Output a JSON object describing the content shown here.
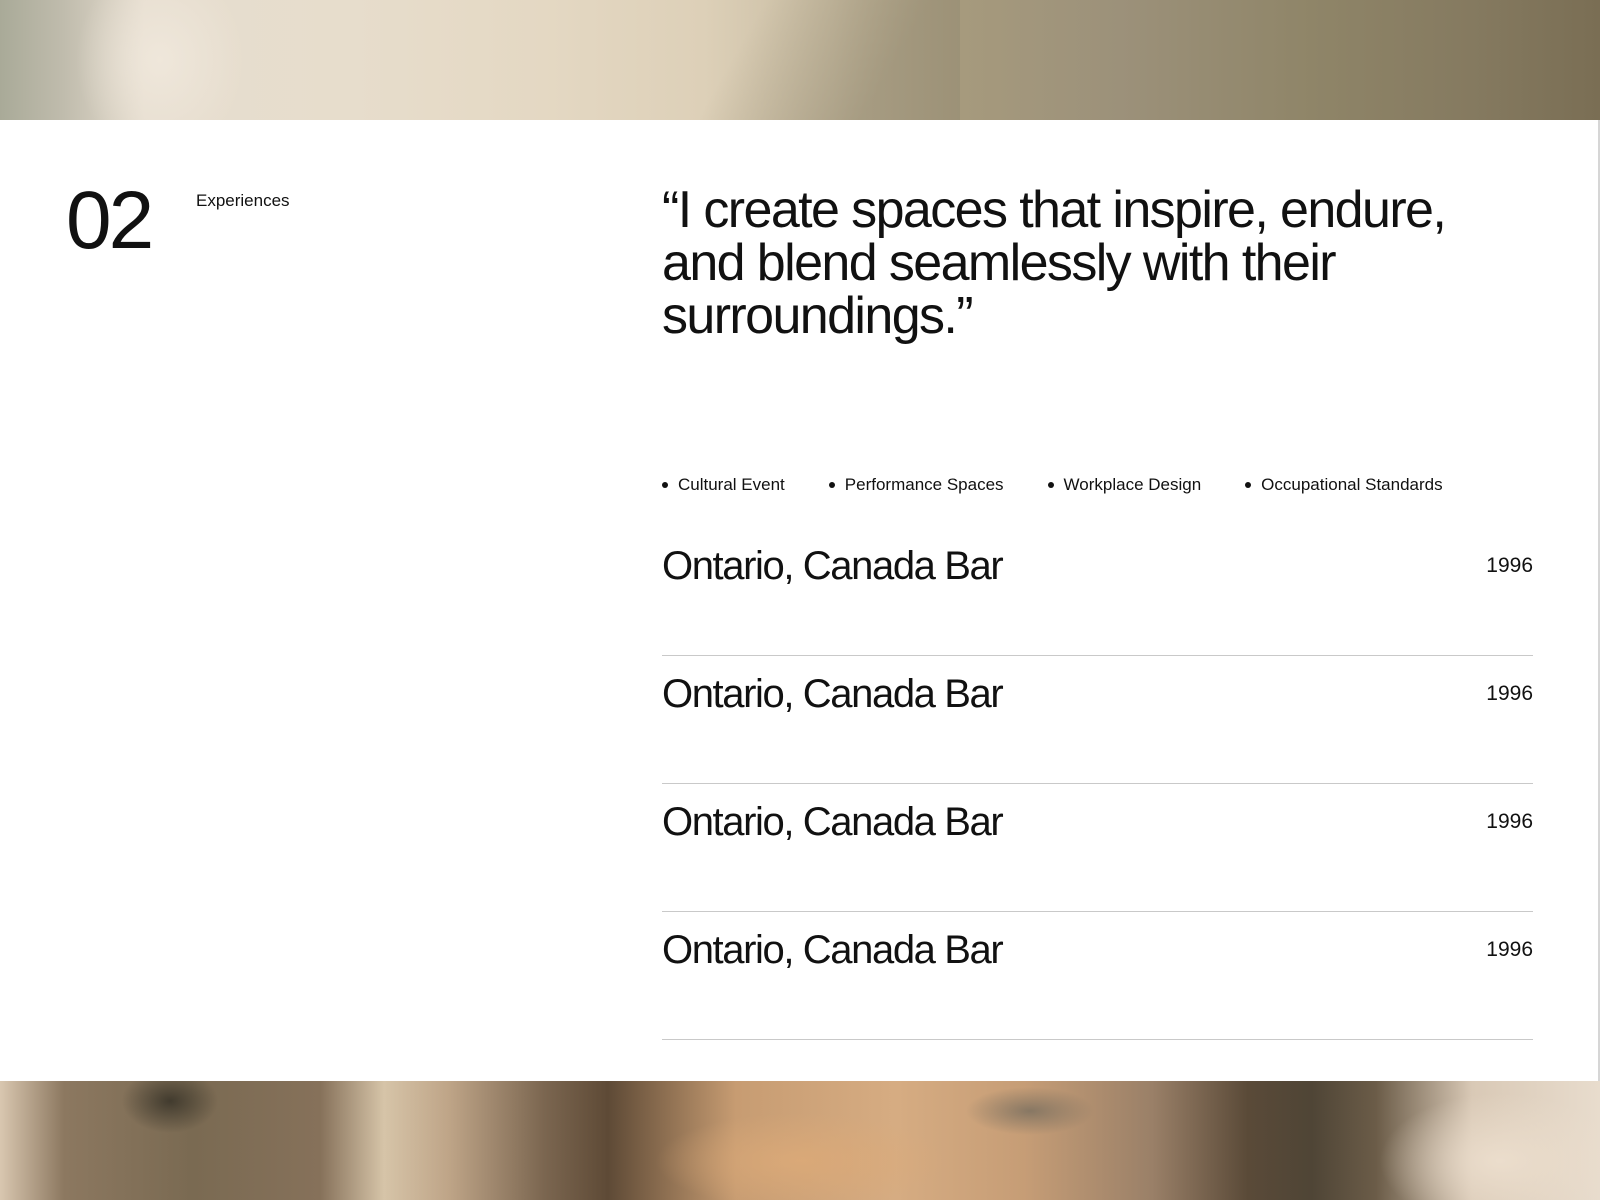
{
  "section": {
    "number": "02",
    "label": "Experiences"
  },
  "quote": "“I create spaces that inspire, endure, and blend seamlessly with their surroundings.”",
  "tags": [
    "Cultural Event",
    "Performance Spaces",
    "Workplace Design",
    "Occupational Standards"
  ],
  "projects": [
    {
      "name": "Ontario, Canada Bar",
      "year": "1996"
    },
    {
      "name": "Ontario, Canada Bar",
      "year": "1996"
    },
    {
      "name": "Ontario, Canada Bar",
      "year": "1996"
    },
    {
      "name": "Ontario, Canada Bar",
      "year": "1996"
    }
  ]
}
